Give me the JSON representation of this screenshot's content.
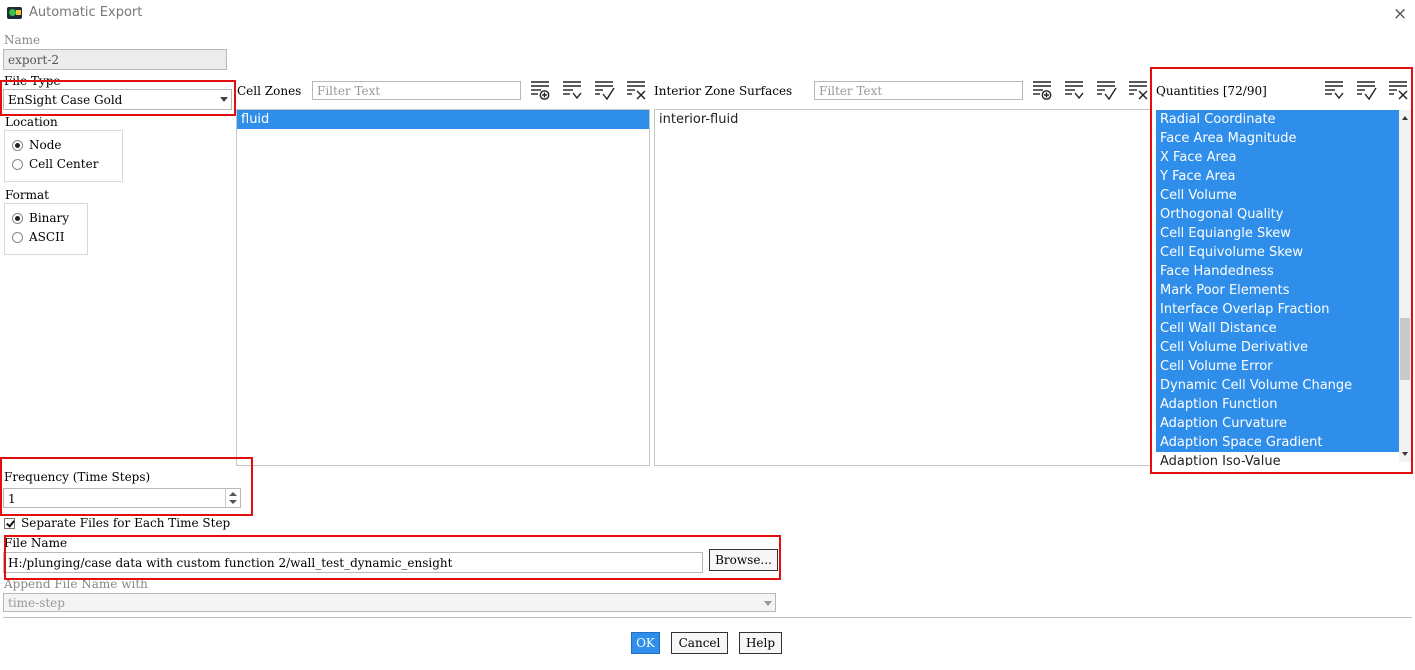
{
  "window": {
    "title": "Automatic Export",
    "close_icon": "×"
  },
  "name": {
    "label": "Name",
    "value": "export-2"
  },
  "file_type": {
    "label": "File Type",
    "selected": "EnSight Case Gold"
  },
  "location": {
    "label": "Location",
    "options": [
      "Node",
      "Cell Center"
    ],
    "selected": "Node"
  },
  "format": {
    "label": "Format",
    "options": [
      "Binary",
      "ASCII"
    ],
    "selected": "Binary"
  },
  "cell_zones": {
    "label": "Cell Zones",
    "filter_placeholder": "Filter Text",
    "items": [
      "fluid"
    ]
  },
  "interior_zones": {
    "label": "Interior Zone Surfaces",
    "filter_placeholder": "Filter Text",
    "items": [
      "interior-fluid"
    ]
  },
  "quantities": {
    "label": "Quantities [72/90]",
    "items": [
      "Radial Coordinate",
      "Face Area Magnitude",
      "X Face Area",
      "Y Face Area",
      "Cell Volume",
      "Orthogonal Quality",
      "Cell Equiangle Skew",
      "Cell Equivolume Skew",
      "Face Handedness",
      "Mark Poor Elements",
      "Interface Overlap Fraction",
      "Cell Wall Distance",
      "Cell Volume Derivative",
      "Cell Volume Error",
      "Dynamic Cell Volume Change",
      "Adaption Function",
      "Adaption Curvature",
      "Adaption Space Gradient",
      "Adaption Iso-Value"
    ]
  },
  "frequency": {
    "label": "Frequency (Time Steps)",
    "value": "1"
  },
  "separate_files": {
    "label": "Separate Files for Each Time Step",
    "checked": true
  },
  "file_name": {
    "label": "File Name",
    "value": "H:/plunging/case data with  custom function 2/wall_test_dynamic_ensight",
    "browse_label": "Browse..."
  },
  "append": {
    "label": "Append File Name with",
    "selected": "time-step"
  },
  "buttons": {
    "ok": "OK",
    "cancel": "Cancel",
    "help": "Help"
  },
  "colors": {
    "selection": "#2f8eea",
    "highlight_box": "#e30f0f"
  }
}
